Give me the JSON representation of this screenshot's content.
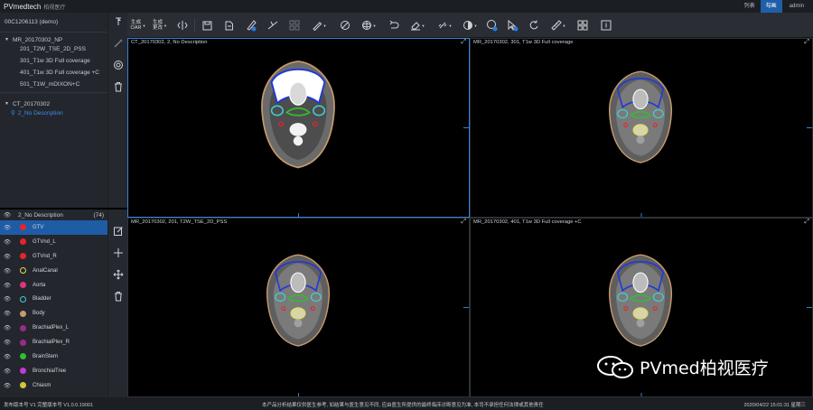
{
  "app": {
    "brand": "PVmedtech",
    "brand_sub": "柏视医疗",
    "nav": [
      "列表",
      "勾画"
    ],
    "user": "admin"
  },
  "patient": {
    "id": "00C1206113 (demo)",
    "studies": [
      {
        "label": "MR_20170302_NP",
        "series": [
          "201_T2W_TSE_2D_PSS",
          "301_T1w 3D Full coverage",
          "401_T1w 3D Full coverage +C",
          "501_T1W_mDIXON+C"
        ]
      },
      {
        "label": "CT_20170302",
        "series": [
          "2_No Description"
        ]
      }
    ]
  },
  "roi_panel": {
    "series_label": "2_No Description",
    "count": "(74)",
    "items": [
      {
        "name": "GTV",
        "color": "#e8232a",
        "style": "fill"
      },
      {
        "name": "GTVnd_L",
        "color": "#e8232a",
        "style": "fill"
      },
      {
        "name": "GTVnd_R",
        "color": "#e8232a",
        "style": "fill"
      },
      {
        "name": "AnalCanal",
        "color": "#e6d84a",
        "style": "ring"
      },
      {
        "name": "Aorta",
        "color": "#e0337d",
        "style": "fill"
      },
      {
        "name": "Bladder",
        "color": "#44cfd1",
        "style": "ring"
      },
      {
        "name": "Body",
        "color": "#c79a6b",
        "style": "fill"
      },
      {
        "name": "BrachialPlex_L",
        "color": "#9b2c86",
        "style": "fill"
      },
      {
        "name": "BrachialPlex_R",
        "color": "#9b2c86",
        "style": "fill"
      },
      {
        "name": "BrainStem",
        "color": "#2fbf2f",
        "style": "fill"
      },
      {
        "name": "BronchialTree",
        "color": "#c43ad6",
        "style": "fill"
      },
      {
        "name": "Chiasm",
        "color": "#d6c43a",
        "style": "fill"
      }
    ]
  },
  "toolbar": {
    "gen_oar_1": "生成",
    "gen_oar_2": "OAR",
    "gen_update_1": "生成",
    "gen_update_2": "更改"
  },
  "viewports": [
    {
      "title": "CT_20170302, 2, No Description",
      "modality": "CT"
    },
    {
      "title": "MR_20170302, 301, T1w 3D Full coverage",
      "modality": "MR"
    },
    {
      "title": "MR_20170302, 201, T2W_TSE_2D_PSS",
      "modality": "MR"
    },
    {
      "title": "MR_20170302, 401, T1w 3D Full coverage +C",
      "modality": "MR"
    }
  ],
  "status": {
    "left": "发布版本号 V1 完整版本号 V1.0.0.19001",
    "center": "本产品分析结果仅供医生参考, 如结果与医生意见不同, 应由医生所提供的最终临床诊断意见为准, 本司不承担任何法律或其他责任",
    "right": "2020/04/22 15:01:31 星期三"
  },
  "watermark": {
    "text": "PVmed柏视医疗"
  },
  "colors": {
    "accent": "#1e5ca6",
    "contour_body": "#c79a6b",
    "contour_blue": "#2237d8",
    "contour_green": "#2fbf2f"
  }
}
